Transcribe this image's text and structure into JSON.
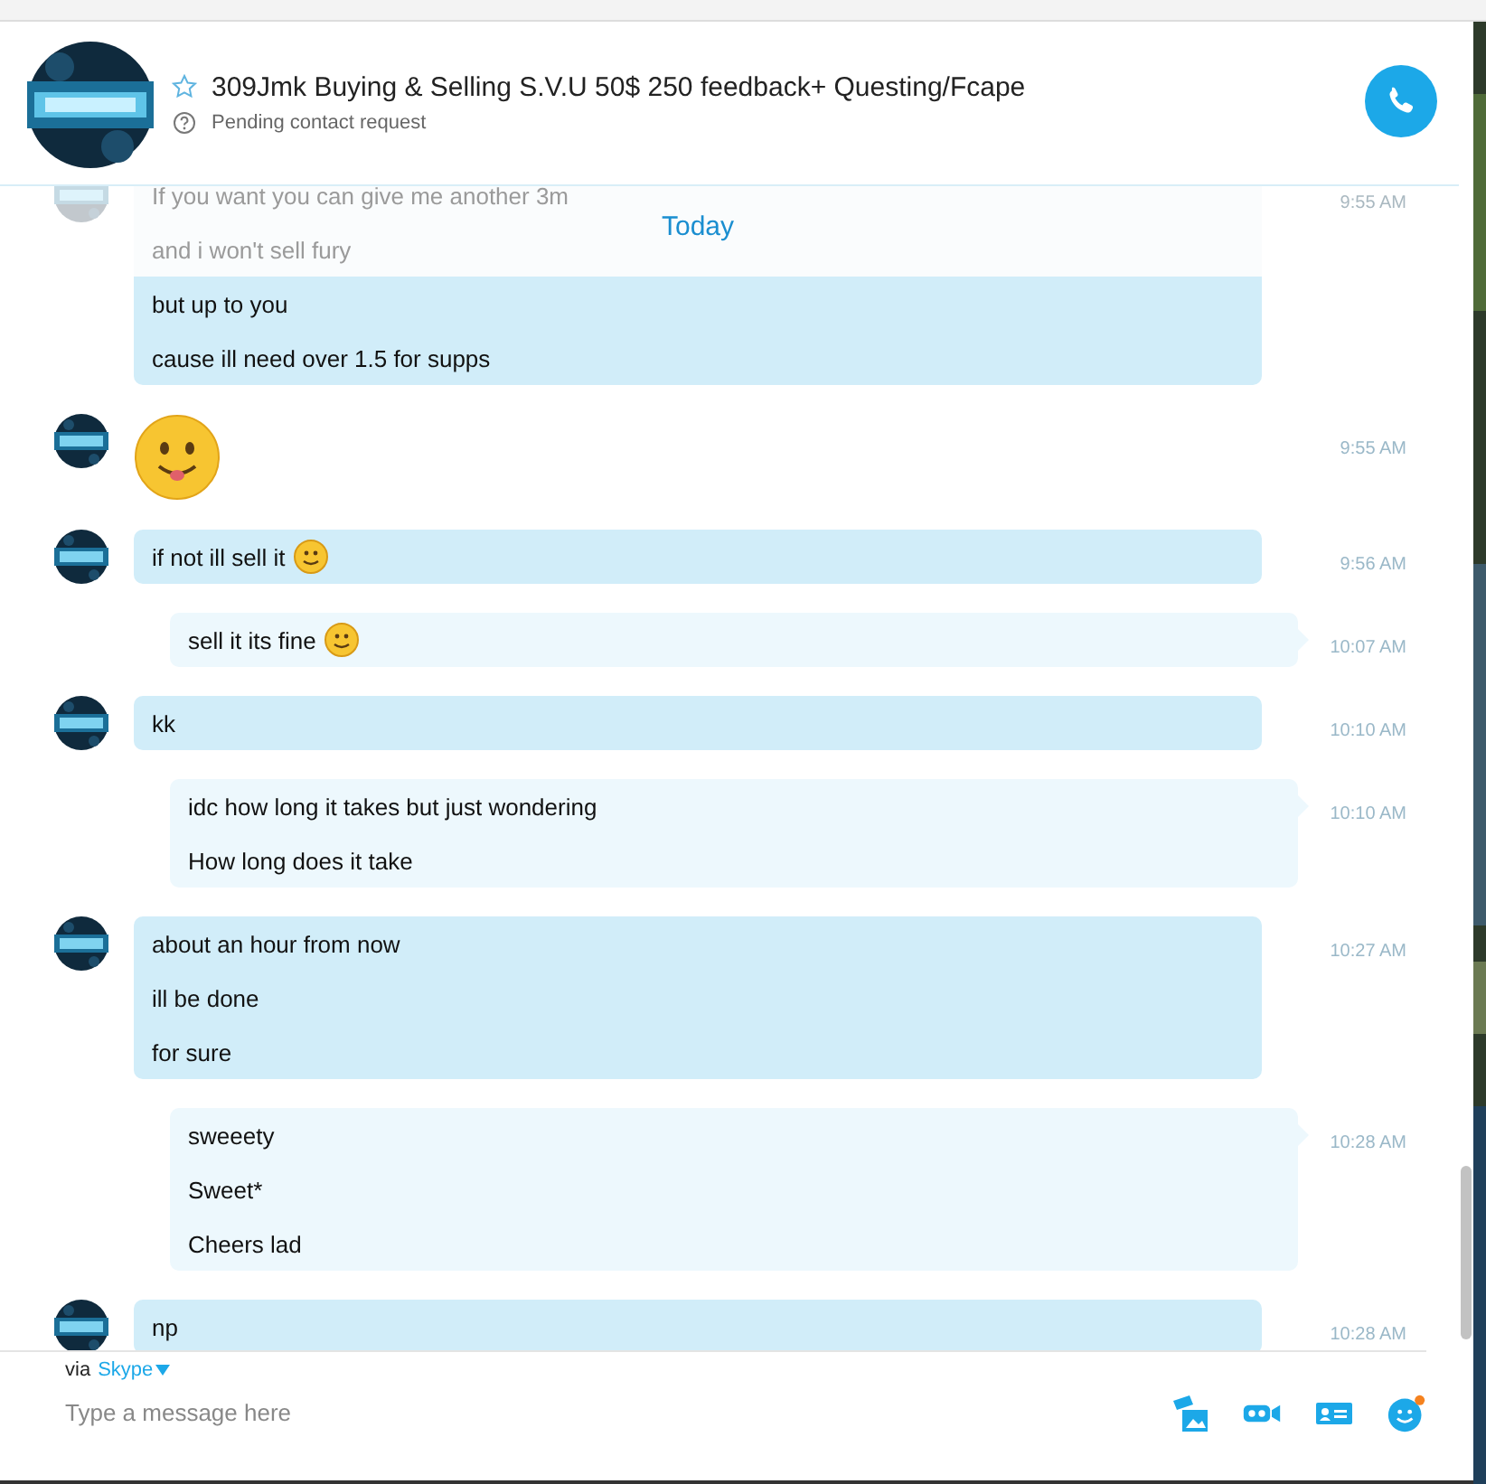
{
  "header": {
    "title": "309Jmk Buying & Selling S.V.U 50$ 250 feedback+ Questing/Fcape",
    "favorite": false,
    "status": "Pending contact request"
  },
  "date_divider": "Today",
  "messages": [
    {
      "kind": "incoming",
      "avatar": true,
      "faded": true,
      "time": "9:55 AM",
      "lines": [
        {
          "text": "If you want you can give me another 3m",
          "faded": true
        },
        {
          "text": "and i won't sell fury",
          "faded": true
        },
        {
          "text": "but up to you",
          "faded": false
        },
        {
          "text": "cause ill need over 1.5 for supps",
          "faded": false
        }
      ]
    },
    {
      "kind": "emoji",
      "avatar": true,
      "faded": false,
      "time": "9:55 AM"
    },
    {
      "kind": "incoming",
      "avatar": true,
      "faded": false,
      "time": "9:56 AM",
      "lines": [
        {
          "text": "if not ill sell it",
          "faded": false,
          "emoji": true
        }
      ]
    },
    {
      "kind": "outgoing",
      "avatar": false,
      "faded": false,
      "time": "10:07 AM",
      "lines": [
        {
          "text": "sell it its fine",
          "faded": false,
          "emoji": true
        }
      ]
    },
    {
      "kind": "incoming",
      "avatar": true,
      "faded": false,
      "time": "10:10 AM",
      "lines": [
        {
          "text": "kk",
          "faded": false
        }
      ]
    },
    {
      "kind": "outgoing",
      "avatar": false,
      "faded": false,
      "time": "10:10 AM",
      "lines": [
        {
          "text": "idc how long it takes but just wondering",
          "faded": false
        },
        {
          "text": "How long does it take",
          "faded": false
        }
      ]
    },
    {
      "kind": "incoming",
      "avatar": true,
      "faded": false,
      "time": "10:27 AM",
      "lines": [
        {
          "text": "about an hour from now",
          "faded": false
        },
        {
          "text": "ill be done",
          "faded": false
        },
        {
          "text": "for sure",
          "faded": false
        }
      ]
    },
    {
      "kind": "outgoing",
      "avatar": false,
      "faded": false,
      "time": "10:28 AM",
      "lines": [
        {
          "text": "sweeety",
          "faded": false
        },
        {
          "text": "Sweet*",
          "faded": false
        },
        {
          "text": "Cheers lad",
          "faded": false
        }
      ]
    },
    {
      "kind": "incoming",
      "avatar": true,
      "faded": false,
      "time": "10:28 AM",
      "lines": [
        {
          "text": "np",
          "faded": false
        }
      ]
    }
  ],
  "compose": {
    "via": "via",
    "network": "Skype",
    "placeholder": "Type a message here",
    "emoji_notification": true
  }
}
